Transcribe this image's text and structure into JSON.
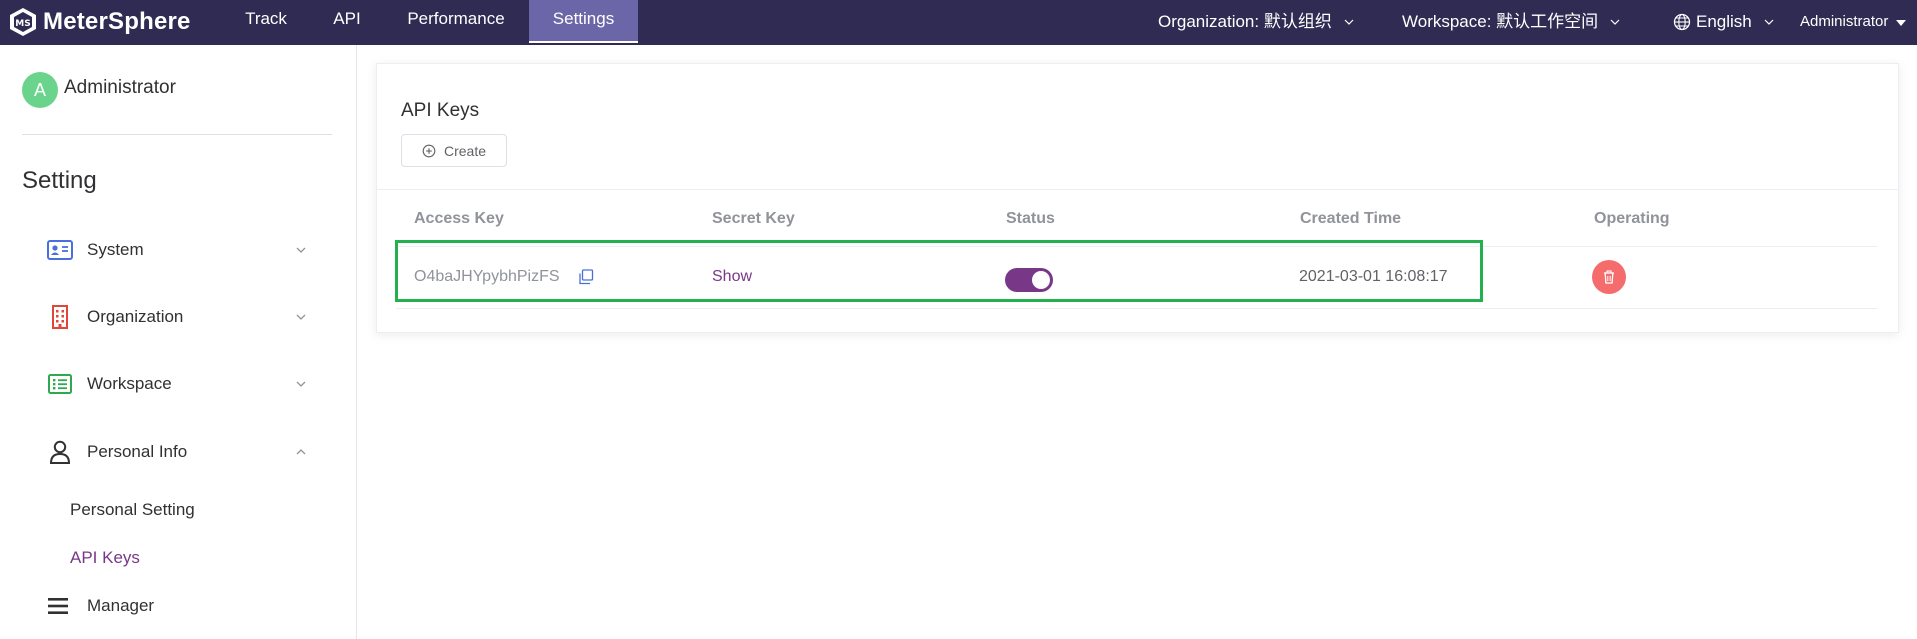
{
  "app": {
    "name": "MeterSphere"
  },
  "nav": {
    "tabs": [
      {
        "label": "Track"
      },
      {
        "label": "API"
      },
      {
        "label": "Performance"
      },
      {
        "label": "Settings",
        "active": true
      }
    ],
    "organization": "Organization: 默认组织",
    "workspace": "Workspace: 默认工作空间",
    "language": "English",
    "user": "Administrator"
  },
  "sidebar": {
    "avatar_letter": "A",
    "user_name": "Administrator",
    "title": "Setting",
    "menu": [
      {
        "label": "System",
        "icon": "id-card-icon",
        "expanded": false
      },
      {
        "label": "Organization",
        "icon": "building-icon",
        "expanded": false
      },
      {
        "label": "Workspace",
        "icon": "list-icon",
        "expanded": false
      },
      {
        "label": "Personal Info",
        "icon": "user-icon",
        "expanded": true
      },
      {
        "label": "Manager",
        "icon": "menu-icon"
      }
    ],
    "personal_sub": [
      {
        "label": "Personal Setting",
        "active": false
      },
      {
        "label": "API Keys",
        "active": true
      }
    ]
  },
  "main": {
    "title": "API Keys",
    "create_label": "Create",
    "columns": [
      "Access Key",
      "Secret Key",
      "Status",
      "Created Time",
      "Operating"
    ],
    "rows": [
      {
        "access_key": "O4baJHYpybhPizFS",
        "secret_key": "Show",
        "status_enabled": true,
        "created_time": "2021-03-01 16:08:17"
      }
    ]
  },
  "colors": {
    "header_bg": "#2f2b52",
    "active_tab": "#6b66a8",
    "primary": "#783887",
    "danger": "#f56c6c",
    "highlight": "#22b14c"
  }
}
